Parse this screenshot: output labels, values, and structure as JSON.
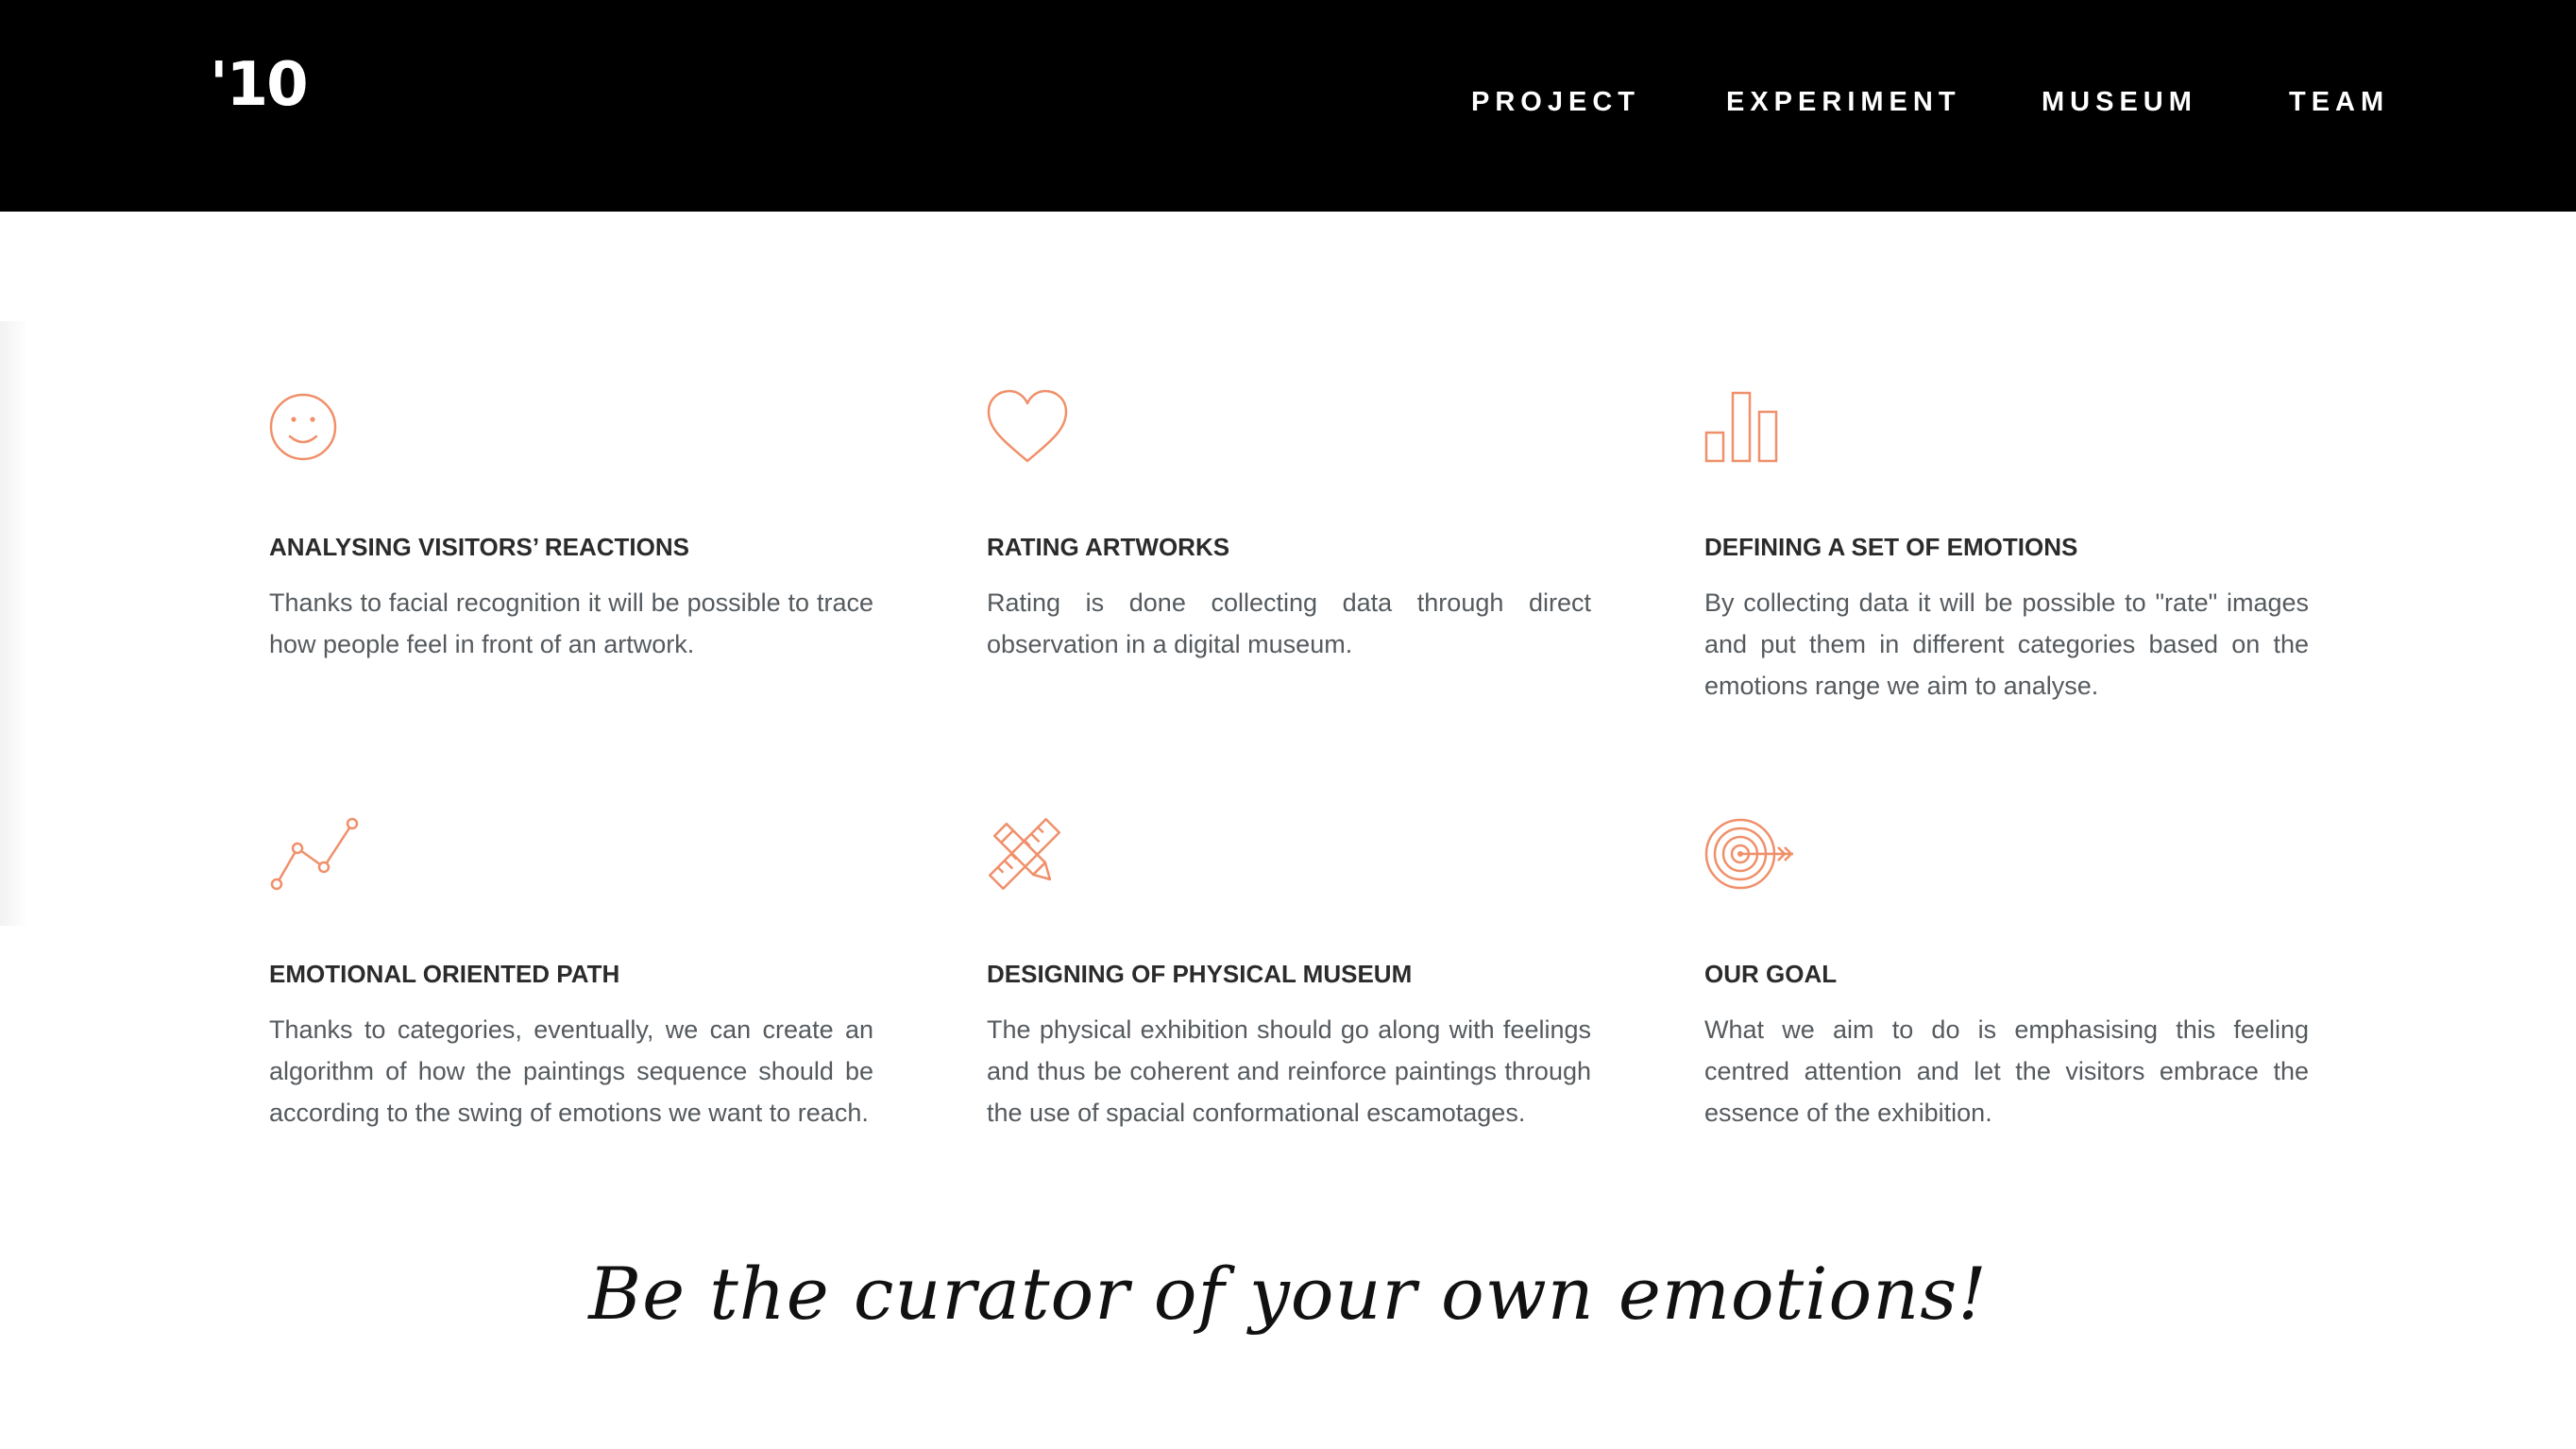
{
  "header": {
    "logo_text": "'10",
    "nav": [
      {
        "label": "PROJECT"
      },
      {
        "label": "EXPERIMENT"
      },
      {
        "label": "MUSEUM"
      },
      {
        "label": "TEAM"
      }
    ]
  },
  "accent_color": "#f0906a",
  "features": [
    {
      "icon": "smiley-face-icon",
      "title": "ANALYSING VISITORS’ REACTIONS",
      "description": "Thanks to facial recognition it will be possible to trace how people feel in front of an artwork."
    },
    {
      "icon": "heart-icon",
      "title": "RATING ARTWORKS",
      "description": "Rating is done collecting data through direct observation in a digital museum."
    },
    {
      "icon": "bar-chart-icon",
      "title": "DEFINING A SET OF EMOTIONS",
      "description": "By collecting data it will be possible to \"rate\" images and put them in different categories based on the emotions range we aim to analyse."
    },
    {
      "icon": "line-graph-icon",
      "title": "EMOTIONAL ORIENTED PATH",
      "description": "Thanks to categories, eventually, we can create an algorithm of how the paintings sequence should be according to the swing of emotions we want to reach."
    },
    {
      "icon": "pencil-ruler-icon",
      "title": "DESIGNING OF PHYSICAL MUSEUM",
      "description": "The physical exhibition should go along with feelings and thus be coherent and reinforce paintings through the use of spacial conformational escamotages."
    },
    {
      "icon": "target-arrow-icon",
      "title": "OUR GOAL",
      "description": "What we aim to do is emphasising this feeling centred attention and let the visitors embrace the essence of the exhibition."
    }
  ],
  "tagline": "Be the curator of your own emotions!"
}
